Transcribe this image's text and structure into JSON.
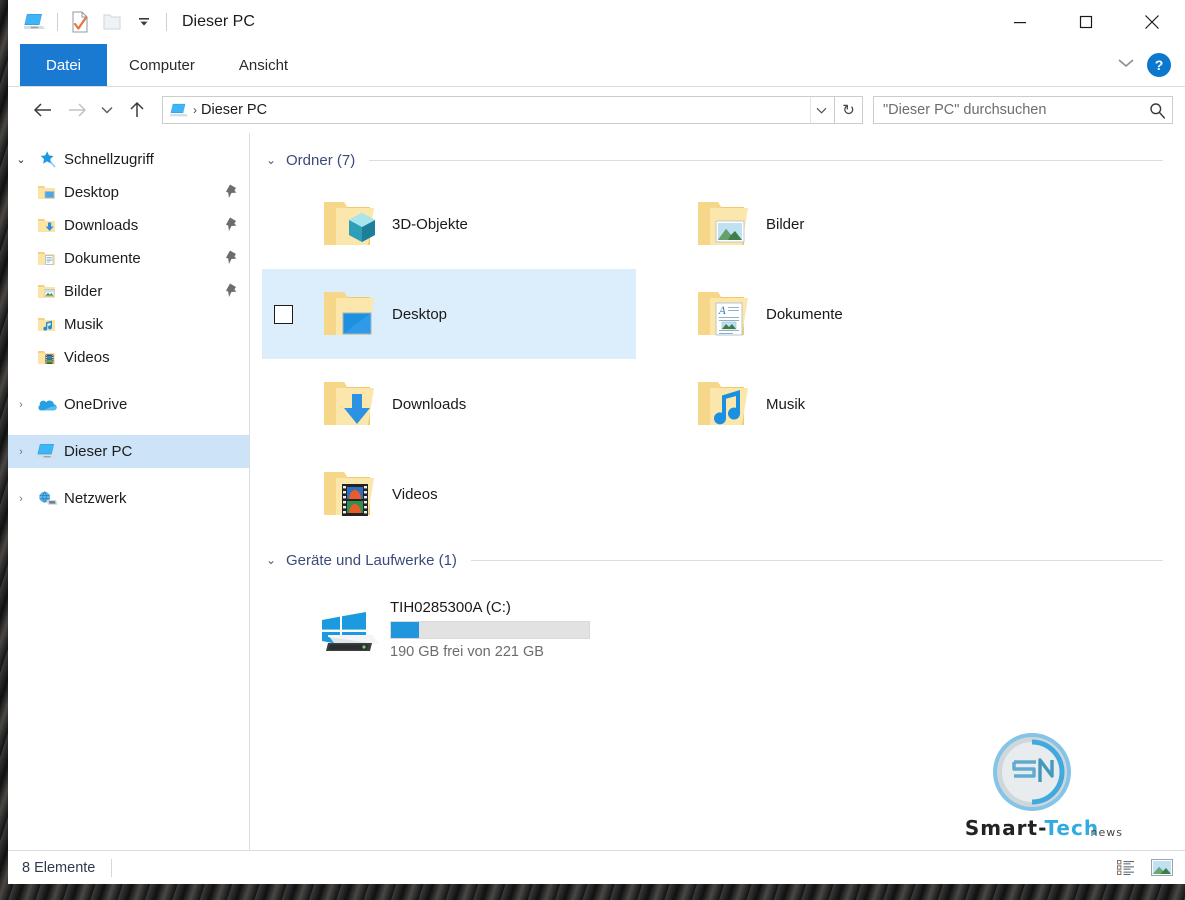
{
  "window": {
    "title": "Dieser PC",
    "quick_access": [
      {
        "name": "this-pc-icon",
        "label": "Dieser PC"
      },
      {
        "name": "properties-icon",
        "label": "Eigenschaften"
      },
      {
        "name": "new-folder-icon",
        "label": "Neuer Ordner"
      },
      {
        "name": "customize-qat-icon",
        "label": "Symbolleiste für den Schnellzugriff anpassen"
      }
    ],
    "controls": {
      "minimize": "minimize-icon",
      "maximize": "maximize-icon",
      "close": "close-icon"
    }
  },
  "ribbon": {
    "tabs": [
      {
        "label": "Datei",
        "active": true
      },
      {
        "label": "Computer",
        "active": false
      },
      {
        "label": "Ansicht",
        "active": false
      }
    ],
    "collapse_label": "∨",
    "help_label": "?"
  },
  "address": {
    "back_label": "←",
    "forward_label": "→",
    "recent_label": "∨",
    "up_label": "↑",
    "path_icon": "this-pc-icon",
    "path": "Dieser PC",
    "separator": "›",
    "dropdown_label": "∨",
    "refresh_label": "↻"
  },
  "search": {
    "placeholder": "\"Dieser PC\" durchsuchen",
    "value": "",
    "icon": "search-icon"
  },
  "sidebar": {
    "items": [
      {
        "label": "Schnellzugriff",
        "icon": "star-pin-icon",
        "chevron": "⌄",
        "expanded": true,
        "indent": false,
        "pinned": false,
        "selected": false
      },
      {
        "label": "Desktop",
        "icon": "folder-desktop-icon",
        "chevron": "",
        "expanded": false,
        "indent": true,
        "pinned": true,
        "selected": false
      },
      {
        "label": "Downloads",
        "icon": "folder-downloads-icon",
        "chevron": "",
        "expanded": false,
        "indent": true,
        "pinned": true,
        "selected": false
      },
      {
        "label": "Dokumente",
        "icon": "folder-documents-icon",
        "chevron": "",
        "expanded": false,
        "indent": true,
        "pinned": true,
        "selected": false
      },
      {
        "label": "Bilder",
        "icon": "folder-pictures-icon",
        "chevron": "",
        "expanded": false,
        "indent": true,
        "pinned": true,
        "selected": false
      },
      {
        "label": "Musik",
        "icon": "folder-music-icon",
        "chevron": "",
        "expanded": false,
        "indent": true,
        "pinned": false,
        "selected": false
      },
      {
        "label": "Videos",
        "icon": "folder-videos-icon",
        "chevron": "",
        "expanded": false,
        "indent": true,
        "pinned": false,
        "selected": false
      },
      {
        "label": "OneDrive",
        "icon": "onedrive-cloud-icon",
        "chevron": "›",
        "expanded": false,
        "indent": false,
        "pinned": false,
        "selected": false
      },
      {
        "label": "Dieser PC",
        "icon": "this-pc-icon",
        "chevron": "›",
        "expanded": false,
        "indent": false,
        "pinned": false,
        "selected": true
      },
      {
        "label": "Netzwerk",
        "icon": "network-icon",
        "chevron": "›",
        "expanded": false,
        "indent": false,
        "pinned": false,
        "selected": false
      }
    ]
  },
  "content": {
    "groups": [
      {
        "title": "Ordner (7)",
        "chevron": "⌄",
        "items": [
          {
            "label": "3D-Objekte",
            "icon": "folder-3dobjects-icon",
            "selected": false
          },
          {
            "label": "Bilder",
            "icon": "folder-pictures-icon",
            "selected": false
          },
          {
            "label": "Desktop",
            "icon": "folder-desktop-icon",
            "selected": true
          },
          {
            "label": "Dokumente",
            "icon": "folder-documents-icon",
            "selected": false
          },
          {
            "label": "Downloads",
            "icon": "folder-downloads-icon",
            "selected": false
          },
          {
            "label": "Musik",
            "icon": "folder-music-icon",
            "selected": false
          },
          {
            "label": "Videos",
            "icon": "folder-videos-icon",
            "selected": false
          }
        ]
      }
    ],
    "drives_group": {
      "title": "Geräte und Laufwerke (1)",
      "chevron": "⌄",
      "drives": [
        {
          "name": "TIH0285300A (C:)",
          "icon": "windows-drive-icon",
          "free_text": "190 GB frei von 221 GB",
          "free_gb": 190,
          "total_gb": 221,
          "used_percent": 14
        }
      ]
    }
  },
  "watermark": {
    "logo_text": "SN",
    "brand_part1": "Smart-",
    "brand_part2": "Tech",
    "brand_suffix": "news"
  },
  "status": {
    "items_text": "8 Elemente",
    "view_details_icon": "details-view-icon",
    "view_large_icons_icon": "large-icons-view-icon"
  },
  "colors": {
    "accent": "#1a79d0",
    "selection": "#dceefb",
    "tree_selection": "#cde3f7",
    "group_title": "#3b4a7a",
    "drive_bar": "#2296dd"
  }
}
